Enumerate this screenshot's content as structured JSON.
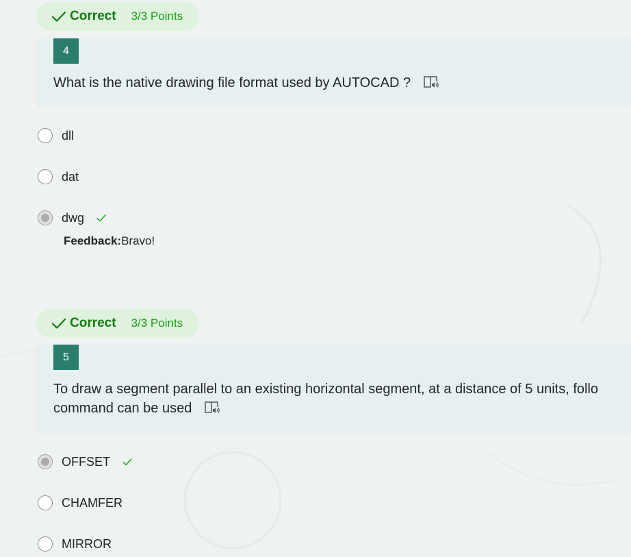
{
  "questions": [
    {
      "status": "Correct",
      "points": "3/3 Points",
      "number": "4",
      "text": "What is the native drawing file format used by AUTOCAD ?",
      "options": [
        {
          "label": "dll",
          "selected": false,
          "correct": false
        },
        {
          "label": "dat",
          "selected": false,
          "correct": false
        },
        {
          "label": "dwg",
          "selected": true,
          "correct": true
        }
      ],
      "feedback_label": "Feedback:",
      "feedback_text": "Bravo!"
    },
    {
      "status": "Correct",
      "points": "3/3 Points",
      "number": "5",
      "text_line1": "To draw a segment parallel to an existing horizontal segment, at a distance of 5 units, follo",
      "text_line2": "command can be used",
      "options": [
        {
          "label": "OFFSET",
          "selected": true,
          "correct": true
        },
        {
          "label": "CHAMFER",
          "selected": false,
          "correct": false
        },
        {
          "label": "MIRROR",
          "selected": false,
          "correct": false
        }
      ]
    }
  ],
  "icons": {
    "status_check": "checkmark-icon",
    "reader": "immersive-reader-icon",
    "answer_check": "correct-answer-check-icon"
  },
  "colors": {
    "correct_green": "#107c10",
    "pill_bg": "#dff2dd",
    "number_badge": "#2b7d6e",
    "question_card_bg": "#e6f0f1",
    "page_bg": "#eef3f1"
  }
}
